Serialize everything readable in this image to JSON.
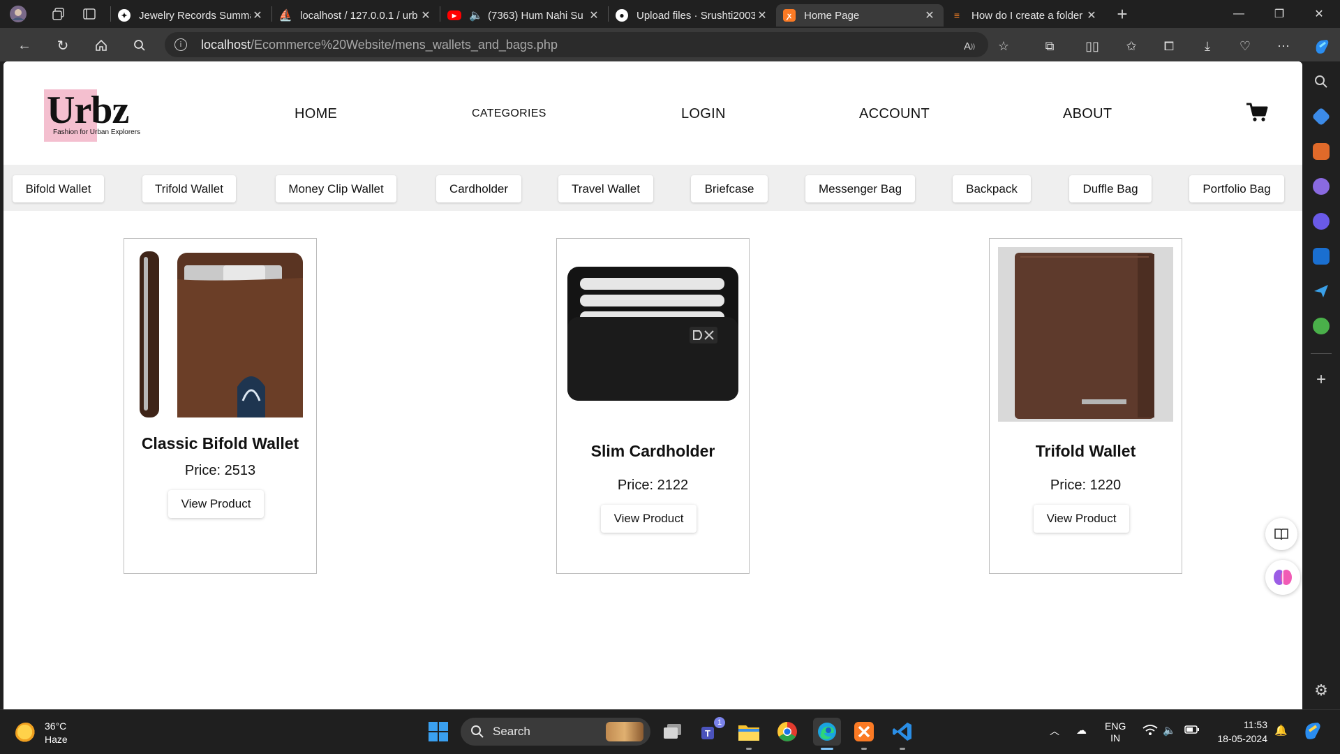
{
  "browser": {
    "tabs": [
      {
        "title": "Jewelry Records Summar",
        "favicon": "chatgpt-icon"
      },
      {
        "title": "localhost / 127.0.0.1 / urb",
        "favicon": "phpmyadmin-icon"
      },
      {
        "title": "(7363) Hum Nahi Su",
        "favicon": "youtube-icon"
      },
      {
        "title": "Upload files · Srushti2003",
        "favicon": "github-icon"
      },
      {
        "title": "Home Page",
        "favicon": "xampp-icon"
      },
      {
        "title": "How do I create a folder",
        "favicon": "stackoverflow-icon"
      }
    ],
    "url_host": "localhost",
    "url_path": "/Ecommerce%20Website/mens_wallets_and_bags.php"
  },
  "site": {
    "logo_text": "Urbz",
    "logo_tagline": "Fashion for Urban Explorers",
    "nav": {
      "home": "HOME",
      "categories": "CATEGORIES",
      "login": "LOGIN",
      "account": "ACCOUNT",
      "about": "ABOUT"
    },
    "categories": [
      "Bifold Wallet",
      "Trifold Wallet",
      "Money Clip Wallet",
      "Cardholder",
      "Travel Wallet",
      "Briefcase",
      "Messenger Bag",
      "Backpack",
      "Duffle Bag",
      "Portfolio Bag"
    ],
    "products": [
      {
        "name": "Classic Bifold Wallet",
        "price": "Price: 2513",
        "button": "View Product"
      },
      {
        "name": "Slim Cardholder",
        "price": "Price: 2122",
        "button": "View Product"
      },
      {
        "name": "Trifold Wallet",
        "price": "Price: 1220",
        "button": "View Product"
      }
    ]
  },
  "taskbar": {
    "weather_temp": "36°C",
    "weather_desc": "Haze",
    "search_placeholder": "Search",
    "teams_badge": "1",
    "lang_line1": "ENG",
    "lang_line2": "IN",
    "time": "11:53",
    "date": "18-05-2024"
  },
  "colors": {
    "brand_pink": "#f4bfcf",
    "wallet_brown": "#5a3422",
    "cardholder_black": "#141414",
    "accent_blue": "#0078d4"
  }
}
